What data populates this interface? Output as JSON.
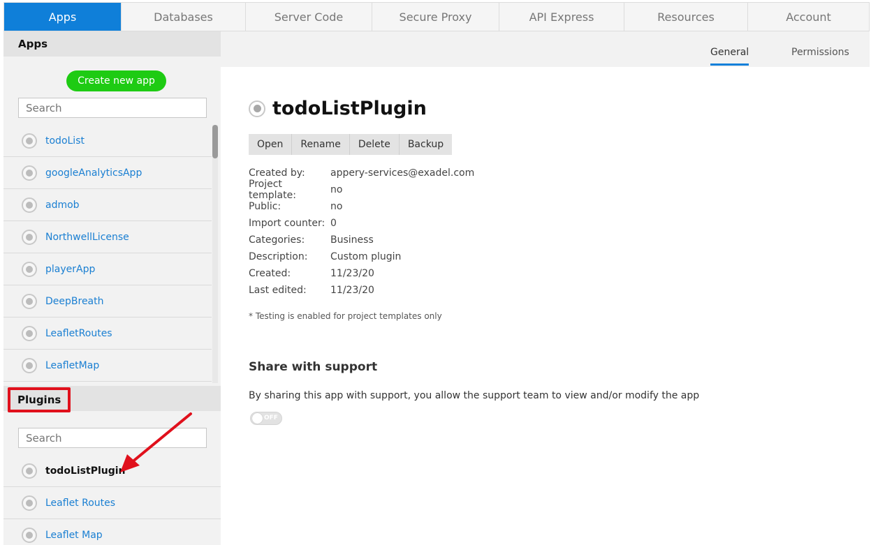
{
  "topnav": {
    "tabs": [
      "Apps",
      "Databases",
      "Server Code",
      "Secure Proxy",
      "API Express",
      "Resources",
      "Account"
    ]
  },
  "sidebar": {
    "apps_heading": "Apps",
    "create_label": "Create new app",
    "search_placeholder": "Search",
    "apps": [
      "todoList",
      "googleAnalyticsApp",
      "admob",
      "NorthwellLicense",
      "playerApp",
      "DeepBreath",
      "LeafletRoutes",
      "LeafletMap"
    ],
    "plugins_heading": "Plugins",
    "plugins_search_placeholder": "Search",
    "plugins": [
      "todoListPlugin",
      "Leaflet Routes",
      "Leaflet Map"
    ]
  },
  "subtabs": {
    "general": "General",
    "permissions": "Permissions"
  },
  "detail": {
    "title": "todoListPlugin",
    "actions": [
      "Open",
      "Rename",
      "Delete",
      "Backup"
    ],
    "info": [
      {
        "k": "Created by:",
        "v": "appery-services@exadel.com"
      },
      {
        "k": "Project template:",
        "v": "no"
      },
      {
        "k": "Public:",
        "v": "no"
      },
      {
        "k": "Import counter:",
        "v": "0"
      },
      {
        "k": "Categories:",
        "v": "Business"
      },
      {
        "k": "Description:",
        "v": "Custom plugin"
      },
      {
        "k": "Created:",
        "v": "11/23/20"
      },
      {
        "k": "Last edited:",
        "v": "11/23/20"
      }
    ],
    "note": "* Testing is enabled for project templates only",
    "share_title": "Share with support",
    "share_text": "By sharing this app with support, you allow the support team to view and/or modify the app",
    "toggle_label": "OFF"
  },
  "colors": {
    "accent": "#0f7fd9",
    "create": "#1ecb13",
    "highlight": "#e0101c"
  }
}
